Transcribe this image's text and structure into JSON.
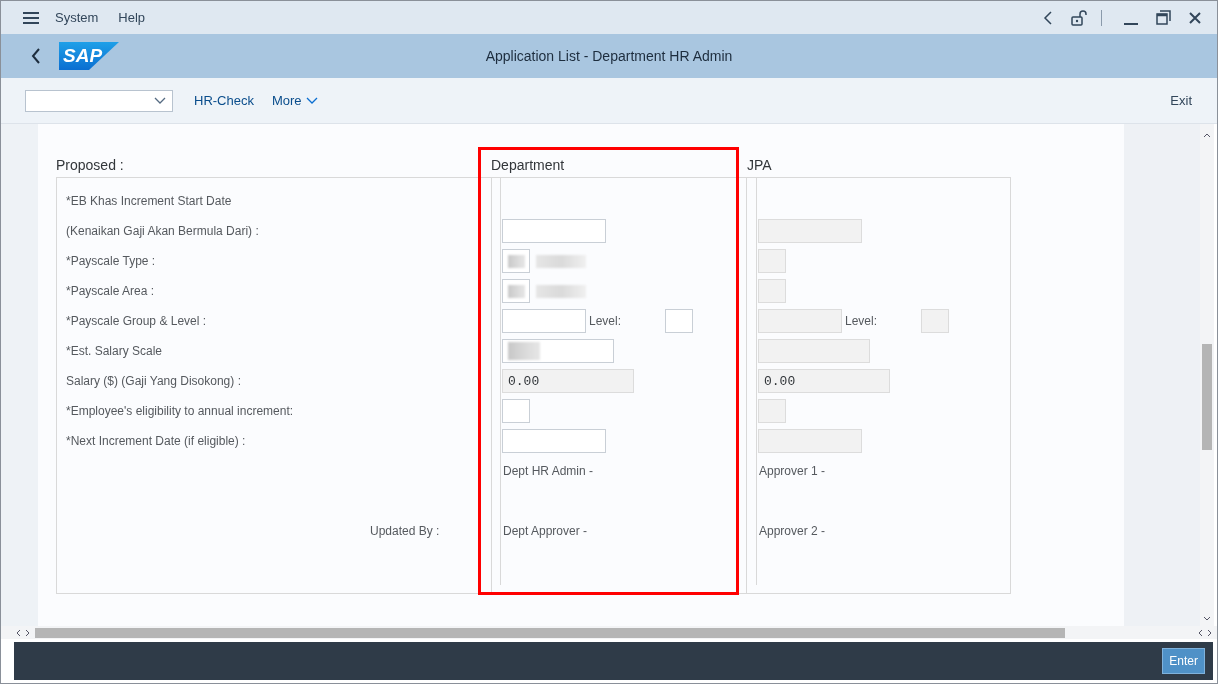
{
  "menu_bar": {
    "items": [
      "System",
      "Help"
    ]
  },
  "title_bar": {
    "logo": "SAP",
    "title": "Application List - Department HR Admin"
  },
  "toolbar": {
    "buttons": [
      "HR-Check",
      "More"
    ],
    "exit": "Exit"
  },
  "form": {
    "label_heading": "Proposed :",
    "department_heading": "Department",
    "jpa_heading": "JPA",
    "highlighted": true,
    "rows": [
      {
        "label": "*EB Khas Increment Start Date"
      },
      {
        "label": "(Kenaikan Gaji Akan Bermula Dari) :",
        "department": {
          "kind": "date",
          "disabled": false
        },
        "jpa": {
          "kind": "date",
          "disabled": true
        }
      },
      {
        "label": "*Payscale Type :",
        "department": {
          "kind": "code",
          "disabled": false,
          "redacted": true
        },
        "jpa": {
          "kind": "code",
          "disabled": true
        }
      },
      {
        "label": "*Payscale Area :",
        "department": {
          "kind": "code",
          "disabled": false,
          "redacted": true
        },
        "jpa": {
          "kind": "code",
          "disabled": true
        }
      },
      {
        "label": "*Payscale Group & Level :",
        "department": {
          "kind": "group",
          "disabled": false,
          "level_label": "Level:"
        },
        "jpa": {
          "kind": "group",
          "disabled": true,
          "level_label": "Level:"
        }
      },
      {
        "label": "*Est. Salary Scale",
        "department": {
          "kind": "scale",
          "disabled": false,
          "redacted": true
        },
        "jpa": {
          "kind": "scale",
          "disabled": true
        }
      },
      {
        "label": "Salary ($) (Gaji Yang Disokong) :",
        "department": {
          "kind": "amount",
          "disabled": true,
          "value": "0.00"
        },
        "jpa": {
          "kind": "amount",
          "disabled": true,
          "value": "0.00"
        }
      },
      {
        "label": "*Employee's eligibility to annual increment:",
        "department": {
          "kind": "flag",
          "disabled": false
        },
        "jpa": {
          "kind": "flag",
          "disabled": true
        }
      },
      {
        "label": "*Next Increment Date (if eligible) :",
        "department": {
          "kind": "date",
          "disabled": false
        },
        "jpa": {
          "kind": "date",
          "disabled": true
        }
      }
    ],
    "updated_by": [
      {
        "department": "Dept HR Admin -",
        "jpa": "Approver 1 -"
      },
      {
        "label": "Updated By :",
        "department": "Dept Approver -",
        "jpa": "Approver 2 -"
      }
    ]
  },
  "footer": {
    "button": "Enter"
  }
}
